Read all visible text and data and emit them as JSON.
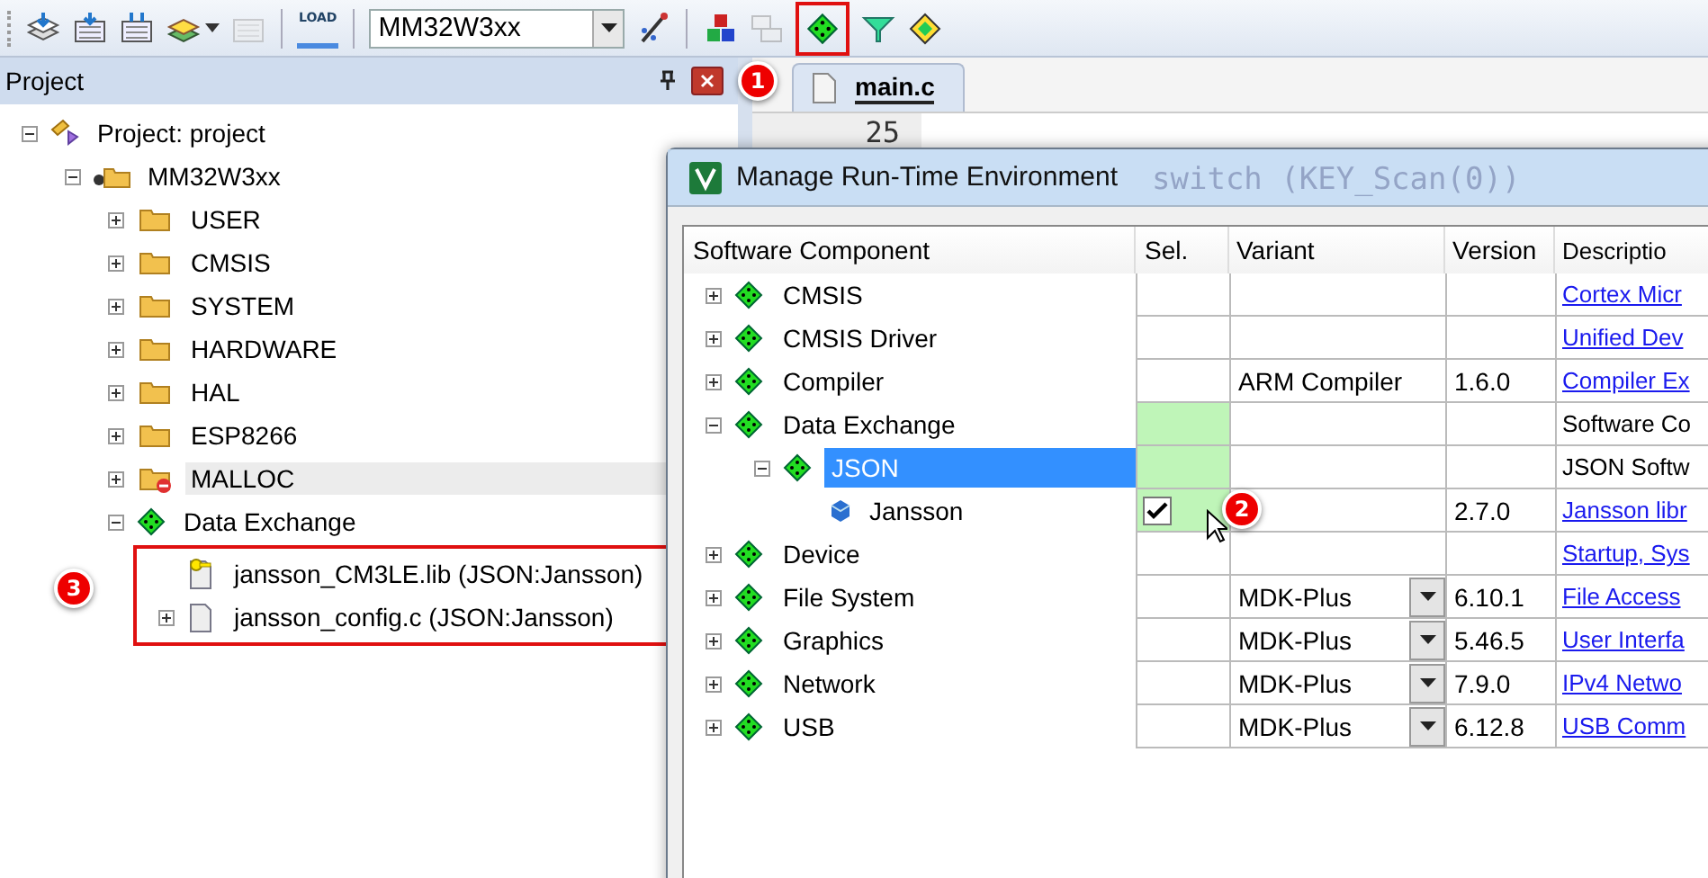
{
  "toolbar": {
    "load_label": "LOAD",
    "target": "MM32W3xx"
  },
  "project_panel": {
    "title": "Project"
  },
  "project_tree": [
    {
      "label": "Project: project",
      "kind": "project",
      "expanded": true,
      "children": [
        {
          "label": "MM32W3xx",
          "kind": "target",
          "expanded": true,
          "children": [
            {
              "label": "USER",
              "kind": "folder",
              "expanded": false
            },
            {
              "label": "CMSIS",
              "kind": "folder",
              "expanded": false
            },
            {
              "label": "SYSTEM",
              "kind": "folder",
              "expanded": false
            },
            {
              "label": "HARDWARE",
              "kind": "folder",
              "expanded": false
            },
            {
              "label": "HAL",
              "kind": "folder",
              "expanded": false
            },
            {
              "label": "ESP8266",
              "kind": "folder",
              "expanded": false
            },
            {
              "label": "MALLOC",
              "kind": "folder-locked",
              "expanded": false,
              "selected": true
            },
            {
              "label": "Data Exchange",
              "kind": "component",
              "expanded": true,
              "children": [
                {
                  "label": "jansson_CM3LE.lib (JSON:Jansson)",
                  "kind": "lib"
                },
                {
                  "label": "jansson_config.c (JSON:Jansson)",
                  "kind": "file",
                  "expanded": false
                }
              ]
            }
          ]
        }
      ]
    }
  ],
  "editor": {
    "tab": "main.c",
    "line_number": "25",
    "code": "switch (KEY_Scan(0))"
  },
  "dialog": {
    "title": "Manage Run-Time Environment",
    "columns": [
      "Software Component",
      "Sel.",
      "Variant",
      "Version",
      "Descriptio"
    ],
    "rows": [
      {
        "name": "CMSIS",
        "expanded": false,
        "selected": false,
        "sel_ok": false,
        "dropdown": false,
        "description": "Cortex Micr",
        "link": true
      },
      {
        "name": "CMSIS Driver",
        "expanded": false,
        "selected": false,
        "sel_ok": false,
        "dropdown": false,
        "description": "Unified Dev",
        "link": true
      },
      {
        "name": "Compiler",
        "expanded": false,
        "selected": false,
        "sel_ok": false,
        "variant": "ARM Compiler",
        "dropdown": false,
        "version": "1.6.0",
        "description": "Compiler Ex",
        "link": true
      },
      {
        "name": "Data Exchange",
        "expanded": true,
        "selected": false,
        "sel_ok": true,
        "dropdown": false,
        "description": "Software Co",
        "link": false,
        "children": [
          {
            "name": "JSON",
            "expanded": true,
            "selected": true,
            "sel_ok": true,
            "dropdown": false,
            "description": "JSON Softw",
            "link": false,
            "children": [
              {
                "name": "Jansson",
                "selected": false,
                "sel_ok": true,
                "checked": true,
                "dropdown": false,
                "version": "2.7.0",
                "description": "Jansson libr",
                "link": true
              }
            ]
          }
        ]
      },
      {
        "name": "Device",
        "expanded": false,
        "selected": false,
        "sel_ok": false,
        "dropdown": false,
        "description": "Startup, Sys",
        "link": true
      },
      {
        "name": "File System",
        "expanded": false,
        "selected": false,
        "sel_ok": false,
        "variant": "MDK-Plus",
        "dropdown": true,
        "version": "6.10.1",
        "description": "File Access",
        "link": true
      },
      {
        "name": "Graphics",
        "expanded": false,
        "selected": false,
        "sel_ok": false,
        "variant": "MDK-Plus",
        "dropdown": true,
        "version": "5.46.5",
        "description": "User Interfa",
        "link": true
      },
      {
        "name": "Network",
        "expanded": false,
        "selected": false,
        "sel_ok": false,
        "variant": "MDK-Plus",
        "dropdown": true,
        "version": "7.9.0",
        "description": "IPv4 Netwo",
        "link": true
      },
      {
        "name": "USB",
        "expanded": false,
        "selected": false,
        "sel_ok": false,
        "variant": "MDK-Plus",
        "dropdown": true,
        "version": "6.12.8",
        "description": "USB Comm",
        "link": true
      }
    ]
  },
  "annotations": [
    "1",
    "2",
    "3"
  ]
}
